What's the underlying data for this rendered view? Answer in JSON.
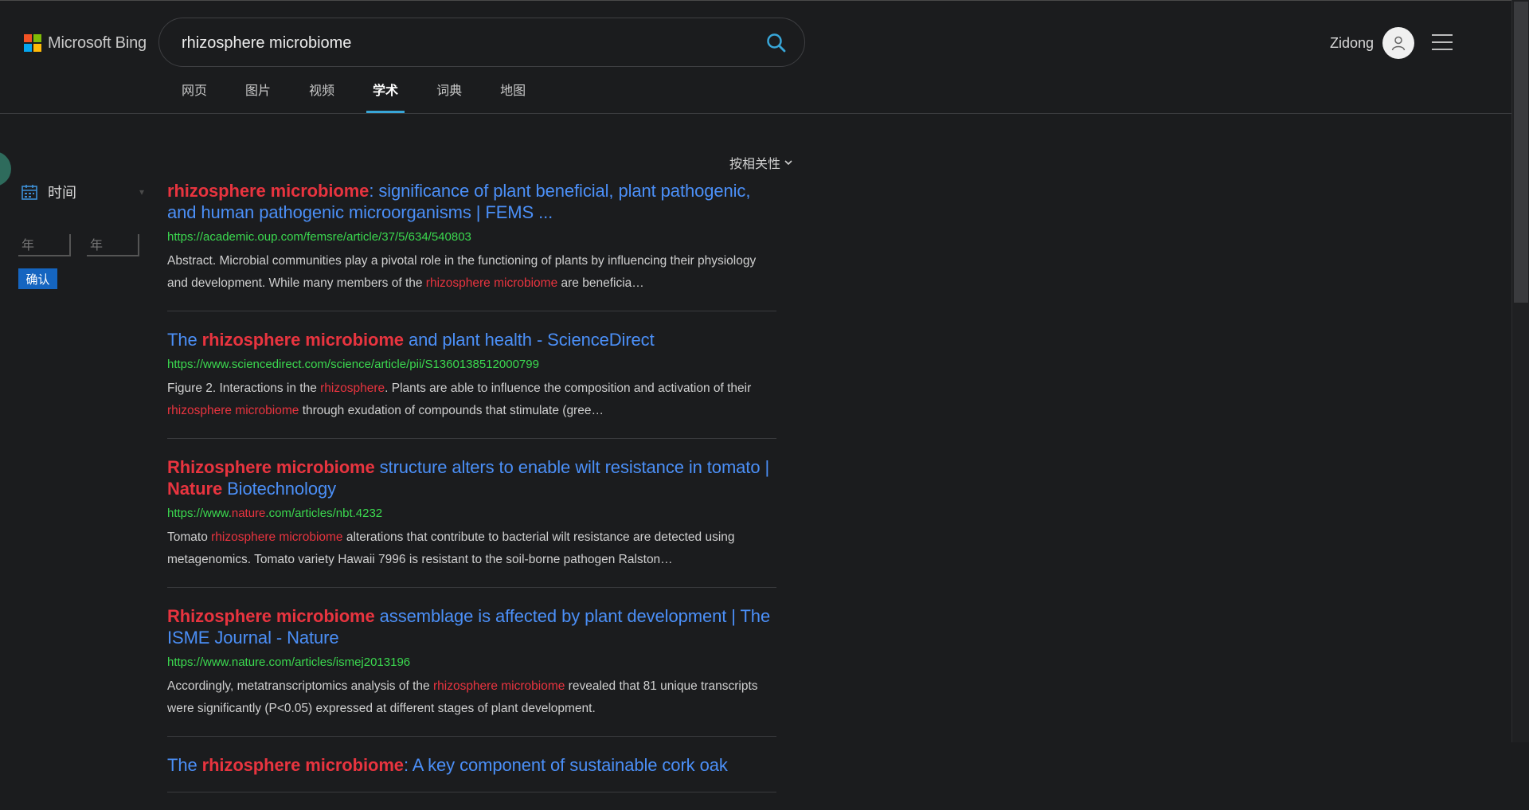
{
  "header": {
    "logo_text": "Microsoft Bing",
    "logo_colors": [
      "#f35325",
      "#81bc06",
      "#05a6f0",
      "#ffba08"
    ],
    "search_value": "rhizosphere microbiome",
    "user_name": "Zidong"
  },
  "tabs": [
    {
      "label": "网页",
      "active": false
    },
    {
      "label": "图片",
      "active": false
    },
    {
      "label": "视频",
      "active": false
    },
    {
      "label": "学术",
      "active": true
    },
    {
      "label": "词典",
      "active": false
    },
    {
      "label": "地图",
      "active": false
    }
  ],
  "sidebar": {
    "filter_label": "时间",
    "year_from_placeholder": "年",
    "year_to_placeholder": "年",
    "confirm_label": "确认"
  },
  "sort_label": "按相关性",
  "colors": {
    "title_link": "#4b8ff7",
    "highlight": "#e8343f",
    "url": "#3bd94f",
    "accent": "#38a6d8",
    "confirm_bg": "#1565c0"
  },
  "results": [
    {
      "title": [
        {
          "t": "rhizosphere microbiome",
          "h": true
        },
        {
          "t": ": significance of plant beneficial, plant pathogenic, and human pathogenic microorganisms | FEMS ...",
          "h": false
        }
      ],
      "url": [
        {
          "t": "https://academic.oup.com/femsre/article/37/5/634/540803",
          "h": false
        }
      ],
      "snippet": [
        {
          "t": "Abstract. Microbial communities play a pivotal role in the functioning of plants by influencing their physiology and development. While many members of the ",
          "h": false
        },
        {
          "t": "rhizosphere microbiome",
          "h": true
        },
        {
          "t": " are beneficia…",
          "h": false
        }
      ]
    },
    {
      "title": [
        {
          "t": "The ",
          "h": false
        },
        {
          "t": "rhizosphere microbiome",
          "h": true
        },
        {
          "t": " and plant health - ScienceDirect",
          "h": false
        }
      ],
      "url": [
        {
          "t": "https://www.sciencedirect.com/science/article/pii/S1360138512000799",
          "h": false
        }
      ],
      "snippet": [
        {
          "t": "Figure 2. Interactions in the ",
          "h": false
        },
        {
          "t": "rhizosphere",
          "h": true
        },
        {
          "t": ". Plants are able to influence the composition and activation of their ",
          "h": false
        },
        {
          "t": "rhizosphere microbiome",
          "h": true
        },
        {
          "t": " through exudation of compounds that stimulate (gree…",
          "h": false
        }
      ]
    },
    {
      "title": [
        {
          "t": "Rhizosphere microbiome",
          "h": true
        },
        {
          "t": " structure alters to enable wilt resistance in tomato | ",
          "h": false
        },
        {
          "t": "Nature",
          "h": true
        },
        {
          "t": " Biotechnology",
          "h": false
        }
      ],
      "url": [
        {
          "t": "https://www.",
          "h": false
        },
        {
          "t": "nature",
          "h": true
        },
        {
          "t": ".com/articles/nbt.4232",
          "h": false
        }
      ],
      "snippet": [
        {
          "t": "Tomato ",
          "h": false
        },
        {
          "t": "rhizosphere microbiome",
          "h": true
        },
        {
          "t": " alterations that contribute to bacterial wilt resistance are detected using metagenomics. Tomato variety Hawaii 7996 is resistant to the soil-borne pathogen Ralston…",
          "h": false
        }
      ]
    },
    {
      "title": [
        {
          "t": "Rhizosphere microbiome",
          "h": true
        },
        {
          "t": " assemblage is affected by plant development | The ISME Journal - Nature",
          "h": false
        }
      ],
      "url": [
        {
          "t": "https://www.nature.com/articles/ismej2013196",
          "h": false
        }
      ],
      "snippet": [
        {
          "t": "Accordingly, metatranscriptomics analysis of the ",
          "h": false
        },
        {
          "t": "rhizosphere microbiome",
          "h": true
        },
        {
          "t": " revealed that 81 unique transcripts were significantly (P<0.05) expressed at different stages of plant development.",
          "h": false
        }
      ]
    },
    {
      "title": [
        {
          "t": "The ",
          "h": false
        },
        {
          "t": "rhizosphere microbiome",
          "h": true
        },
        {
          "t": ": A key component of sustainable cork oak",
          "h": false
        }
      ],
      "url": [],
      "snippet": []
    }
  ]
}
